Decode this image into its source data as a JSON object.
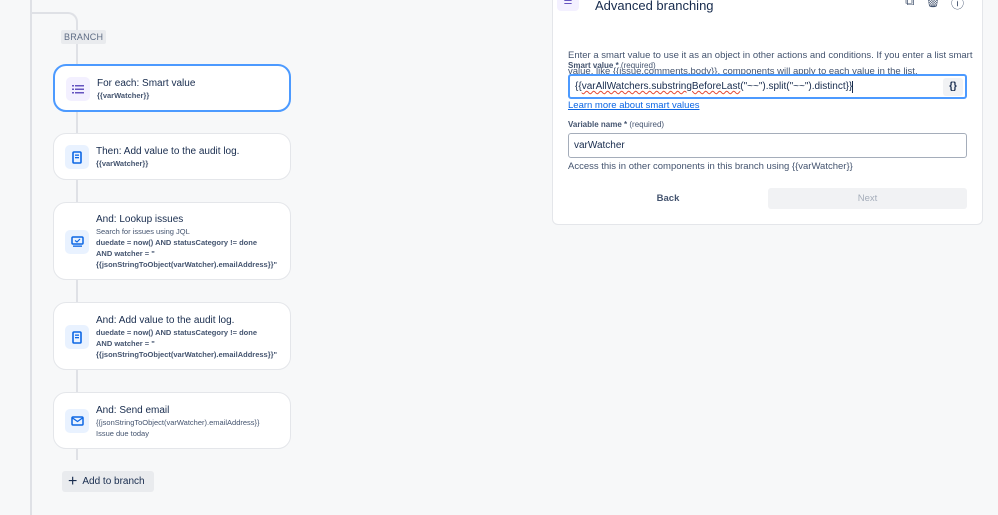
{
  "branch": {
    "badge": "BRANCH",
    "cards": [
      {
        "title": "For each: Smart value",
        "lines": [
          "{{varWatcher}}"
        ]
      },
      {
        "title": "Then: Add value to the audit log.",
        "lines": [
          "{{varWatcher}}"
        ]
      },
      {
        "title": "And: Lookup issues",
        "subtitle": "Search for issues using JQL",
        "lines": [
          "duedate = now() AND statusCategory != done",
          "AND watcher = \"",
          "{{jsonStringToObject(varWatcher).emailAddress}}\""
        ]
      },
      {
        "title": "And: Add value to the audit log.",
        "lines": [
          "duedate = now() AND statusCategory != done",
          "AND watcher = \"",
          "{{jsonStringToObject(varWatcher).emailAddress}}\""
        ]
      },
      {
        "title": "And: Send email",
        "sublines": [
          "{{jsonStringToObject(varWatcher).emailAddress}}",
          "Issue due today"
        ]
      }
    ],
    "add_label": "Add to branch"
  },
  "panel": {
    "title": "Advanced branching",
    "description": "Enter a smart value to use it as an object in other actions and conditions. If you enter a list smart value, like {{issue.comments.body}}, components will apply to each value in the list.",
    "smart_value_label": "Smart value",
    "required": "(required)",
    "smart_value_pre": "{{",
    "smart_value_misspelled": "varAllWatchers.substringBeforeLast",
    "smart_value_post": "(\"~~\").split(\"~~\").distinct}}",
    "brace_button": "{}",
    "learn_more": "Learn more about smart values",
    "variable_label": "Variable name",
    "variable_value": "varWatcher",
    "helper": "Access this in other components in this branch using {{varWatcher}}",
    "back": "Back",
    "next": "Next"
  }
}
